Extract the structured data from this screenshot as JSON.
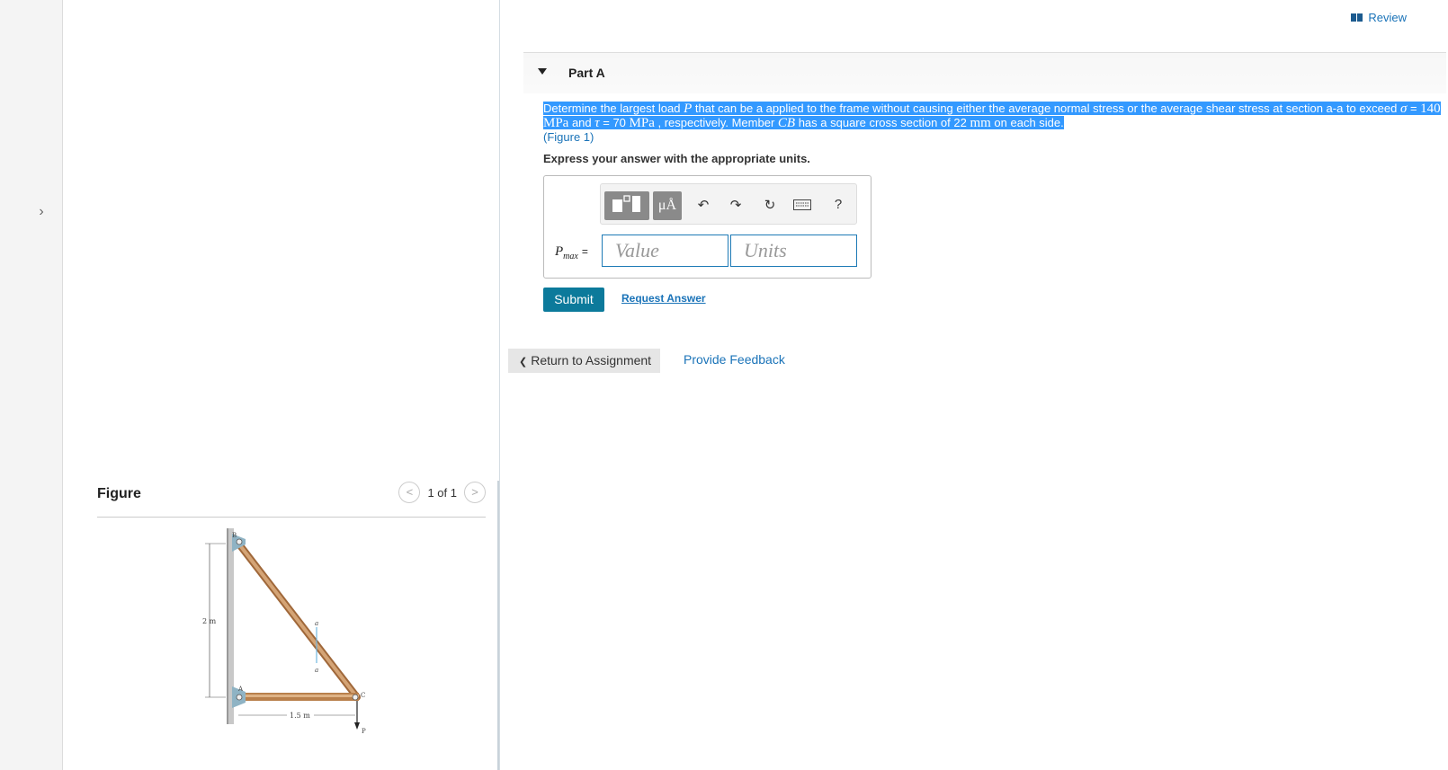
{
  "rail": {
    "toggle_icon": "chevron-right-icon"
  },
  "header": {
    "review_label": "Review"
  },
  "part": {
    "title": "Part A"
  },
  "problem": {
    "t1": "Determine the largest load ",
    "P": "P",
    "t2": " that can be a applied to the frame without causing either the average normal stress or the average shear stress at section a-a to exceed ",
    "sigma": "σ",
    "eq1": " = ",
    "sigma_val": "140 MPa",
    "t3": " and ",
    "tau": "τ",
    "eq2": " = 70 ",
    "tau_unit": "MPa",
    "t4": " , respectively. Member ",
    "CB": "CB",
    "t5": " has a square cross section of 22 ",
    "mm": "mm",
    "t6": " on each side.",
    "figure_link": "(Figure 1)"
  },
  "express": "Express your answer with the appropriate units.",
  "toolbar": {
    "units_btn": "μÅ",
    "help": "?"
  },
  "answer": {
    "label_var": "P",
    "label_sub": "max",
    "label_eq": "=",
    "value_placeholder": "Value",
    "units_placeholder": "Units"
  },
  "actions": {
    "submit": "Submit",
    "request_answer": "Request Answer"
  },
  "footer": {
    "return_label": "Return to Assignment",
    "return_chevron": "❮",
    "feedback": "Provide Feedback"
  },
  "figure": {
    "title": "Figure",
    "count": "1 of 1",
    "prev": "<",
    "next": ">",
    "labels": {
      "B": "B",
      "A": "A",
      "C": "C",
      "P": "P",
      "a_top": "a",
      "a_bottom": "a",
      "height": "2 m",
      "width": "1.5 m"
    }
  }
}
